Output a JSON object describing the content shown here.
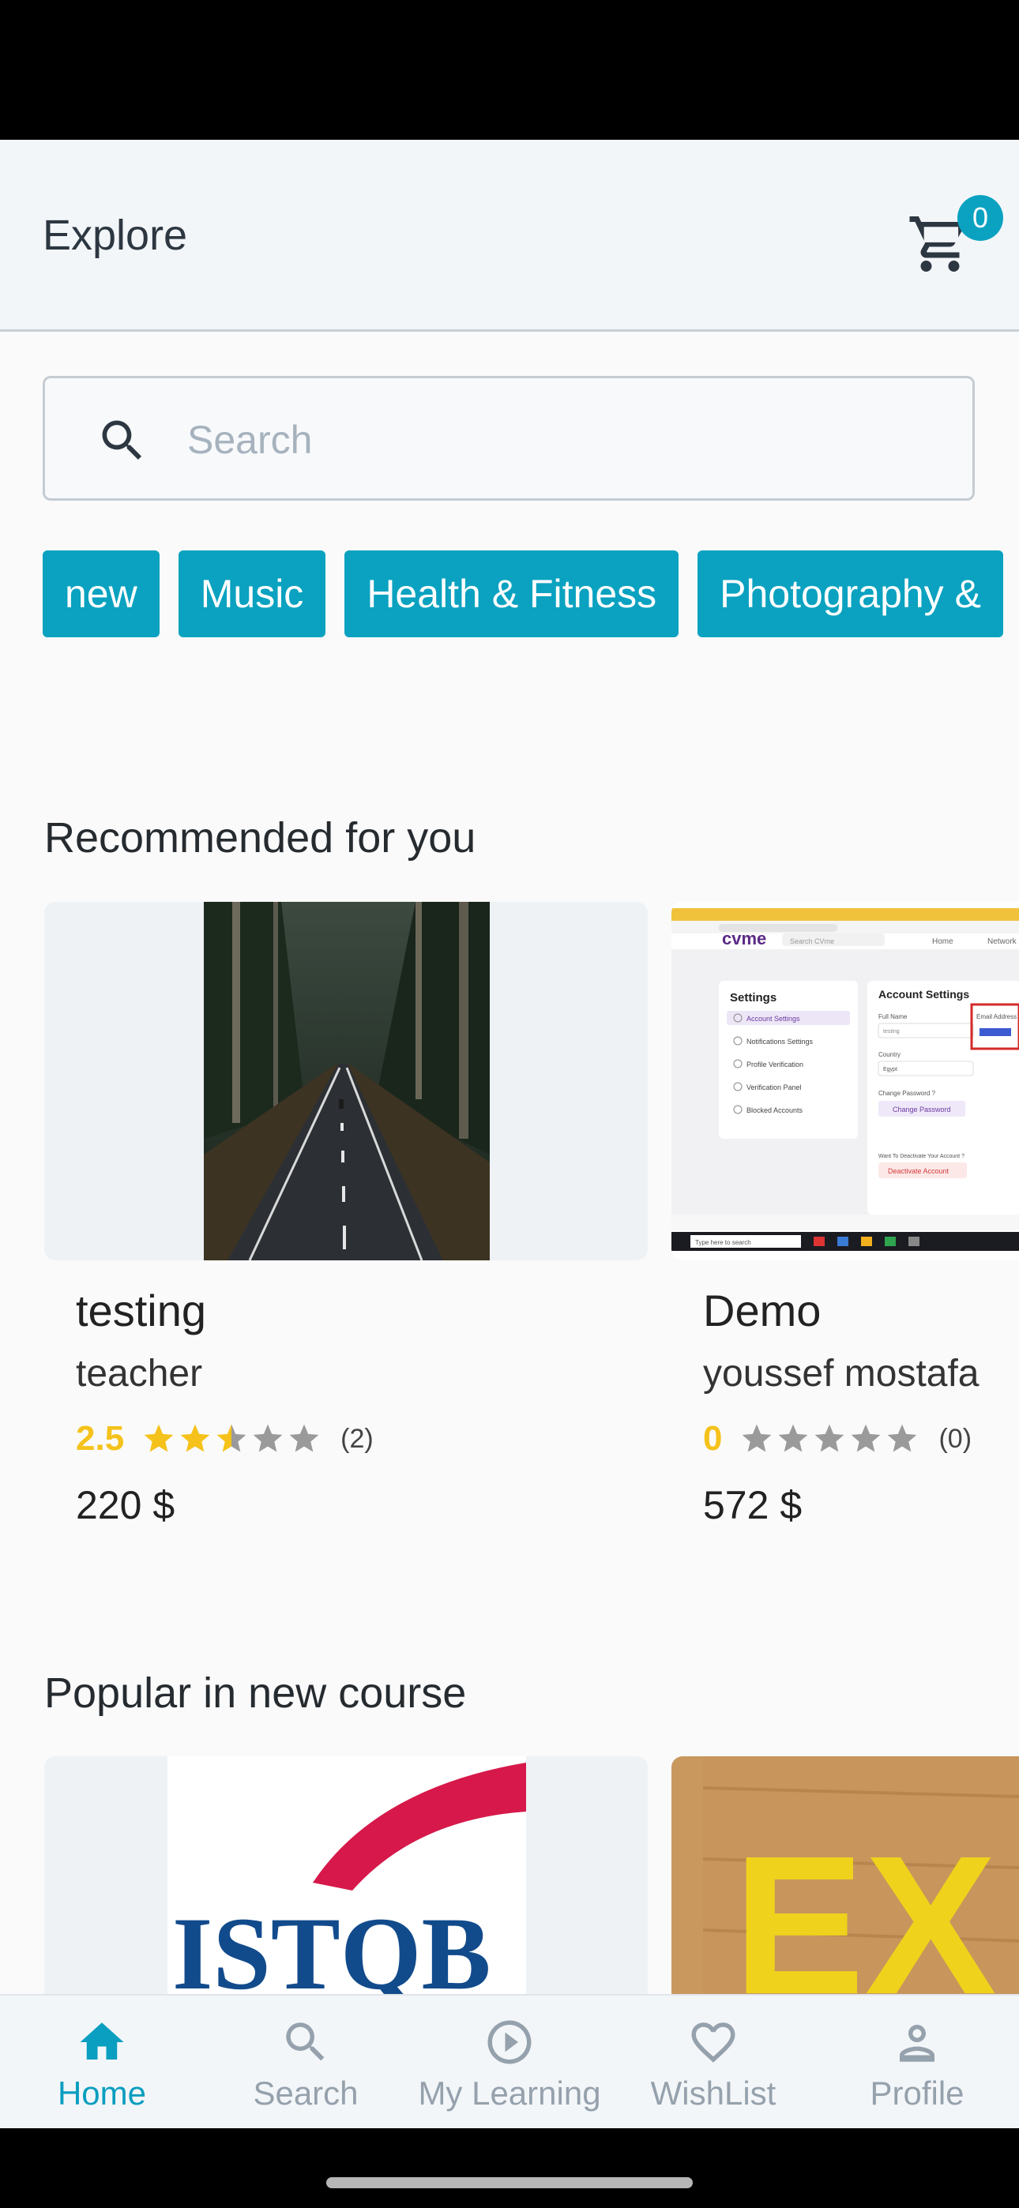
{
  "app_bar": {
    "title": "Explore",
    "cart_count": "0"
  },
  "search": {
    "placeholder": "Search"
  },
  "categories": [
    "new",
    "Music",
    "Health & Fitness",
    "Photography &"
  ],
  "recommended": {
    "title": "Recommended for you",
    "courses": [
      {
        "title": "testing",
        "teacher": "teacher",
        "rating": "2.5",
        "rating_value": 2.5,
        "reviews": "(2)",
        "price": "220 $"
      },
      {
        "title": "Demo",
        "teacher": "youssef mostafa",
        "rating": "0",
        "rating_value": 0,
        "reviews": "(0)",
        "price": "572 $"
      }
    ]
  },
  "thumb_text": {
    "brand": "cvme",
    "search": "Search CVme",
    "nav_home": "Home",
    "nav_network": "Network",
    "settings": "Settings",
    "account_settings": "Account Settings",
    "notifications": "Notifications Settings",
    "profile_verification": "Profile Verification",
    "verification_panel": "Verification Panel",
    "blocked": "Blocked Accounts",
    "full_name": "Full Name",
    "full_name_value": "testing",
    "email": "Email Address",
    "country": "Country",
    "country_value": "Egypt",
    "change_password_q": "Change Password ?",
    "change_password": "Change Password",
    "deactivate_q": "Want To Deactivate Your Account ?",
    "deactivate": "Deactivate Account",
    "taskbar_search": "Type here to search",
    "logo_text": "ISTQB",
    "letters": "EX"
  },
  "popular": {
    "title": "Popular in new course"
  },
  "nav": {
    "items": [
      {
        "label": "Home",
        "icon": "home-icon"
      },
      {
        "label": "Search",
        "icon": "search-icon"
      },
      {
        "label": "My Learning",
        "icon": "play-circle-icon"
      },
      {
        "label": "WishList",
        "icon": "heart-icon"
      },
      {
        "label": "Profile",
        "icon": "person-icon"
      }
    ]
  },
  "colors": {
    "accent": "#0aa2c0",
    "star": "#f5c21b",
    "star_empty": "#9a9a9a",
    "logo_red": "#d6194a",
    "logo_blue": "#124b8c"
  }
}
